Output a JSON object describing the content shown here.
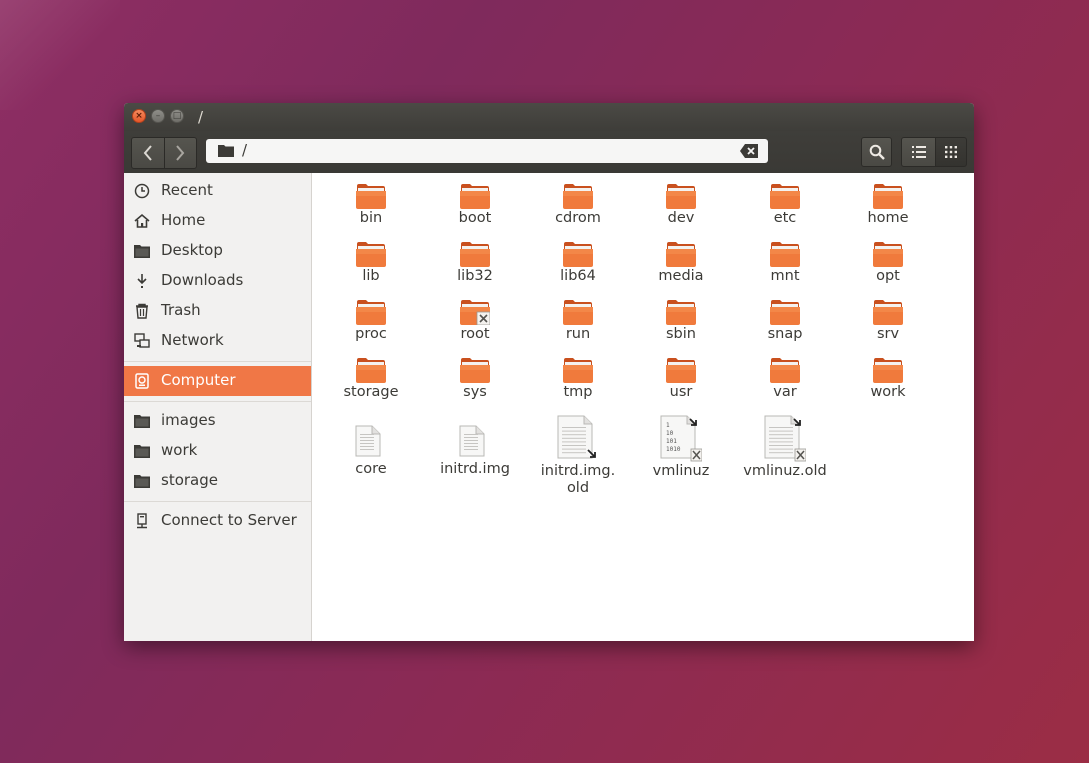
{
  "window": {
    "title": "/"
  },
  "toolbar": {
    "back_icon": "chevron-left-icon",
    "forward_icon": "chevron-right-icon",
    "path": "/",
    "search_icon": "search-icon",
    "list_view_icon": "list-view-icon",
    "grid_view_icon": "grid-view-icon"
  },
  "sidebar": {
    "places": [
      {
        "label": "Recent",
        "icon": "clock-icon"
      },
      {
        "label": "Home",
        "icon": "home-icon"
      },
      {
        "label": "Desktop",
        "icon": "folder-icon"
      },
      {
        "label": "Downloads",
        "icon": "download-icon"
      },
      {
        "label": "Trash",
        "icon": "trash-icon"
      },
      {
        "label": "Network",
        "icon": "network-icon"
      }
    ],
    "devices": [
      {
        "label": "Computer",
        "icon": "computer-icon",
        "active": true
      }
    ],
    "bookmarks": [
      {
        "label": "images",
        "icon": "folder-icon"
      },
      {
        "label": "work",
        "icon": "folder-icon"
      },
      {
        "label": "storage",
        "icon": "folder-icon"
      }
    ],
    "connect": {
      "label": "Connect to Server",
      "icon": "server-icon"
    }
  },
  "files": [
    {
      "name": "bin",
      "type": "folder"
    },
    {
      "name": "boot",
      "type": "folder"
    },
    {
      "name": "cdrom",
      "type": "folder"
    },
    {
      "name": "dev",
      "type": "folder"
    },
    {
      "name": "etc",
      "type": "folder"
    },
    {
      "name": "home",
      "type": "folder"
    },
    {
      "name": "lib",
      "type": "folder"
    },
    {
      "name": "lib32",
      "type": "folder"
    },
    {
      "name": "lib64",
      "type": "folder"
    },
    {
      "name": "media",
      "type": "folder"
    },
    {
      "name": "mnt",
      "type": "folder"
    },
    {
      "name": "opt",
      "type": "folder"
    },
    {
      "name": "proc",
      "type": "folder"
    },
    {
      "name": "root",
      "type": "folder-locked"
    },
    {
      "name": "run",
      "type": "folder"
    },
    {
      "name": "sbin",
      "type": "folder"
    },
    {
      "name": "snap",
      "type": "folder"
    },
    {
      "name": "srv",
      "type": "folder"
    },
    {
      "name": "storage",
      "type": "folder"
    },
    {
      "name": "sys",
      "type": "folder"
    },
    {
      "name": "tmp",
      "type": "folder"
    },
    {
      "name": "usr",
      "type": "folder"
    },
    {
      "name": "var",
      "type": "folder"
    },
    {
      "name": "work",
      "type": "folder"
    },
    {
      "name": "core",
      "type": "file-small"
    },
    {
      "name": "initrd.img",
      "type": "file-small"
    },
    {
      "name": "initrd.img.",
      "name2": "old",
      "type": "file-link"
    },
    {
      "name": "vmlinuz",
      "type": "binary-link"
    },
    {
      "name": "vmlinuz.old",
      "type": "file-link-locked"
    }
  ]
}
